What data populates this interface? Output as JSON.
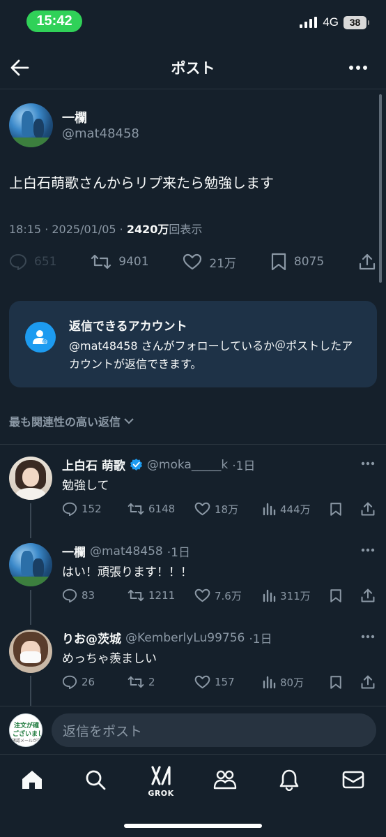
{
  "status_bar": {
    "time": "15:42",
    "network": "4G",
    "battery": "38"
  },
  "header": {
    "title": "ポスト"
  },
  "post": {
    "author_name": "一欄",
    "author_handle": "@mat48458",
    "text": "上白石萌歌さんからリプ来たら勉強します",
    "timestamp": "18:15 · 2025/01/05 · ",
    "views_count": "2420万",
    "views_label": "回表示",
    "replies": "651",
    "reposts": "9401",
    "likes": "21万",
    "bookmarks": "8075"
  },
  "reply_restriction": {
    "title": "返信できるアカウント",
    "body": "@mat48458 さんがフォローしているか＠ポストしたアカウントが返信できます。"
  },
  "sort": {
    "label": "最も関連性の高い返信"
  },
  "replies": [
    {
      "name": "上白石 萌歌",
      "verified": true,
      "handle": "@moka_____k",
      "age": "·1日",
      "text": "勉強して",
      "replies": "152",
      "reposts": "6148",
      "likes": "18万",
      "views": "444万"
    },
    {
      "name": "一欄",
      "verified": false,
      "handle": "@mat48458",
      "age": "·1日",
      "text": "はい！頑張ります！！！",
      "replies": "83",
      "reposts": "1211",
      "likes": "7.6万",
      "views": "311万"
    },
    {
      "name": "りお@茨城",
      "verified": false,
      "handle": "@KemberlyLu99756",
      "age": "·1日",
      "text": "めっちゃ羨ましい",
      "replies": "26",
      "reposts": "2",
      "likes": "157",
      "views": "80万"
    }
  ],
  "compose": {
    "placeholder": "返信をポスト",
    "avatar_line1": "注文が確",
    "avatar_line2": "ございまし",
    "avatar_line3": "確認メールが送信"
  },
  "tabbar": {
    "grok_label": "GROK"
  },
  "colors": {
    "background": "#15202b",
    "accent": "#1d9bf0",
    "muted": "#8b98a5",
    "status_green": "#30d158"
  }
}
